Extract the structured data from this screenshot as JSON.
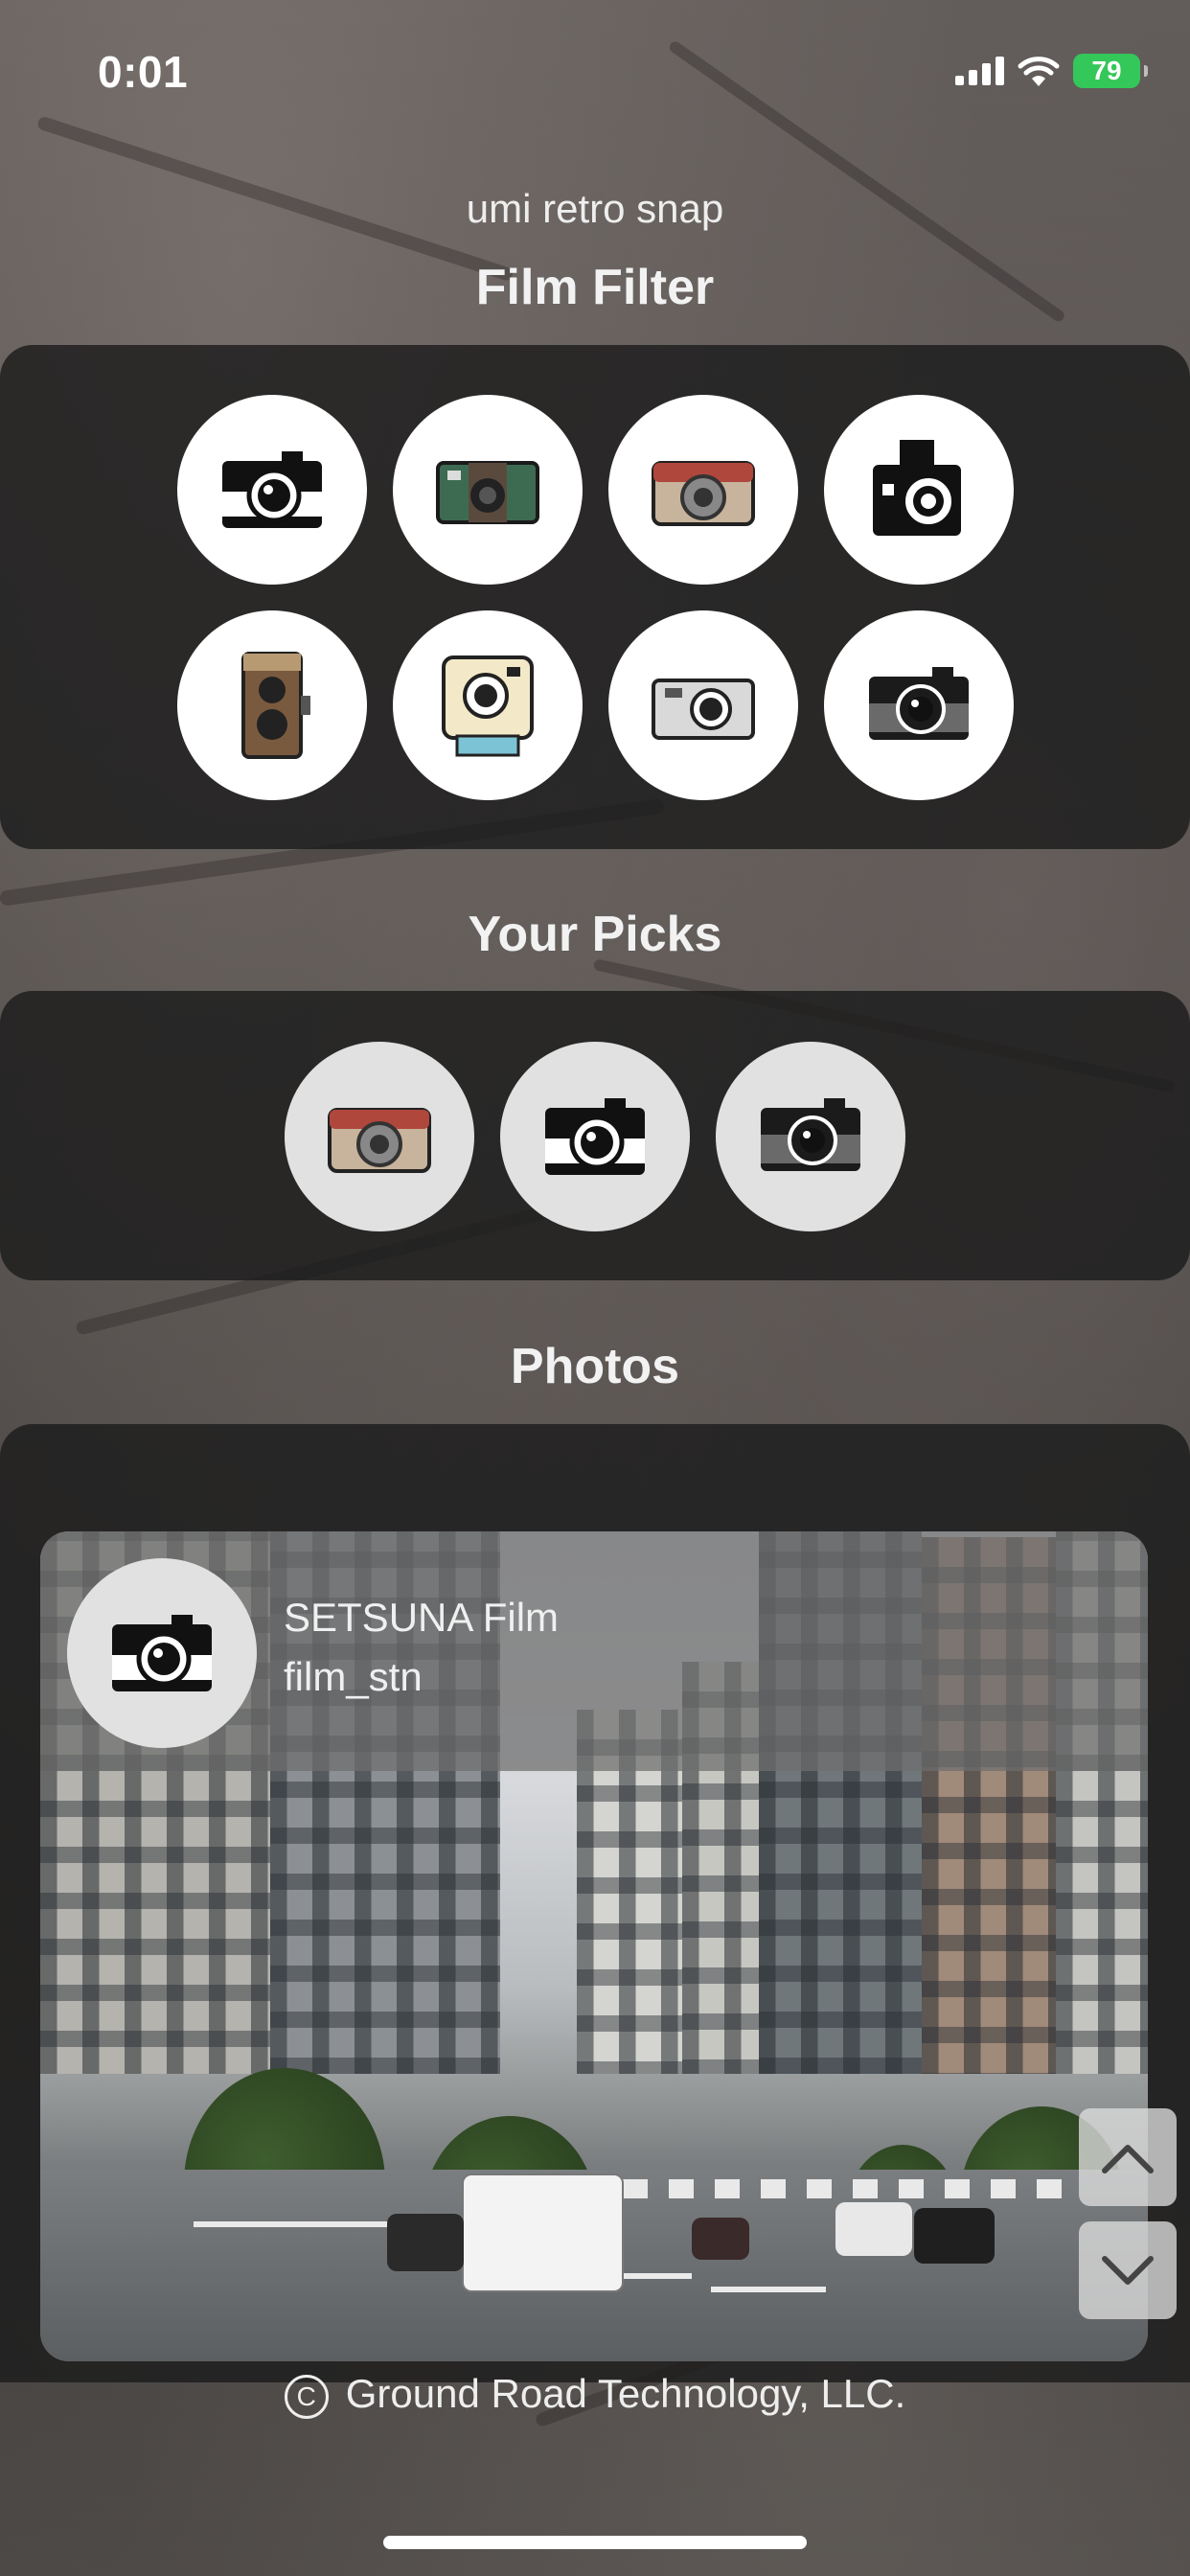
{
  "status_bar": {
    "time": "0:01",
    "battery": "79"
  },
  "header": {
    "app_name": "umi retro snap",
    "title": "Film Filter"
  },
  "film_filter": {
    "cameras": [
      {
        "icon": "black-rangefinder-camera-icon"
      },
      {
        "icon": "green-compact-camera-icon"
      },
      {
        "icon": "brown-retro-camera-icon"
      },
      {
        "icon": "medium-format-camera-icon"
      },
      {
        "icon": "twin-lens-reflex-camera-icon"
      },
      {
        "icon": "instant-camera-icon"
      },
      {
        "icon": "silver-compact-camera-icon"
      },
      {
        "icon": "black-compact-camera-icon"
      }
    ]
  },
  "picks": {
    "title": "Your Picks",
    "cameras": [
      {
        "icon": "brown-retro-camera-icon"
      },
      {
        "icon": "black-rangefinder-camera-icon"
      },
      {
        "icon": "black-compact-camera-icon"
      }
    ]
  },
  "photos": {
    "title": "Photos",
    "card": {
      "film_name": "SETSUNA Film",
      "film_id": "film_stn"
    }
  },
  "footer": {
    "copyright_symbol": "C",
    "copyright": "Ground Road Technology, LLC."
  },
  "colors": {
    "panel": "#1c1c1c",
    "battery": "#34c759",
    "circle": "#ffffff",
    "circle_light": "#e1e1e1"
  }
}
